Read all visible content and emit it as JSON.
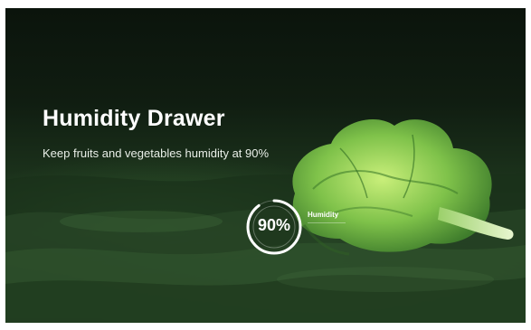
{
  "hero": {
    "title": "Humidity Drawer",
    "subtitle": "Keep fruits and vegetables humidity at 90%"
  },
  "gauge": {
    "value_text": "90%",
    "label": "Humidity",
    "level_percent": 90,
    "ring_color": "#ffffff"
  },
  "image": {
    "subject_icon": "lettuce-icon",
    "leaf_color": "#7fc24a",
    "background_color": "#1c331c"
  }
}
